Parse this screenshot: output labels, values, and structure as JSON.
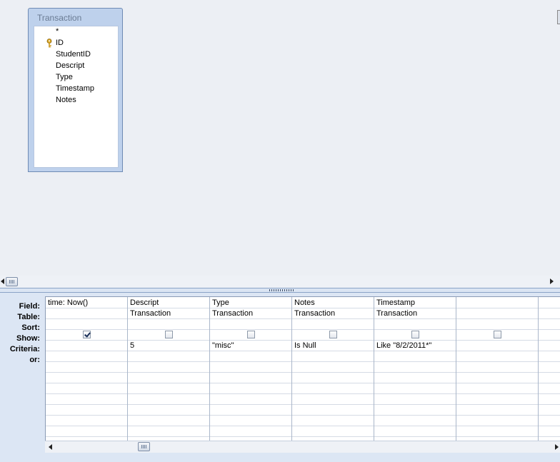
{
  "table_box": {
    "title": "Transaction",
    "fields": [
      "*",
      "ID",
      "StudentID",
      "Descript",
      "Type",
      "Timestamp",
      "Notes"
    ],
    "primary_key_field": "ID",
    "key_icon": "key-icon"
  },
  "grid": {
    "row_labels": [
      "Field:",
      "Table:",
      "Sort:",
      "Show:",
      "Criteria:",
      "or:"
    ],
    "columns": [
      {
        "field": "time: Now()",
        "table": "",
        "sort": "",
        "show": true,
        "criteria": "",
        "or": ""
      },
      {
        "field": "Descript",
        "table": "Transaction",
        "sort": "",
        "show": false,
        "criteria": "5",
        "or": ""
      },
      {
        "field": "Type",
        "table": "Transaction",
        "sort": "",
        "show": false,
        "criteria": "\"misc\"",
        "or": ""
      },
      {
        "field": "Notes",
        "table": "Transaction",
        "sort": "",
        "show": false,
        "criteria": "Is Null",
        "or": ""
      },
      {
        "field": "Timestamp",
        "table": "Transaction",
        "sort": "",
        "show": false,
        "criteria": "Like \"8/2/2011*\"",
        "or": ""
      },
      {
        "field": "",
        "table": "",
        "sort": "",
        "show": false,
        "criteria": "",
        "or": ""
      }
    ]
  },
  "colors": {
    "design_background": "#eceff4",
    "grid_pane_background": "#dce6f4",
    "table_box_border": "#6f8bb4"
  }
}
